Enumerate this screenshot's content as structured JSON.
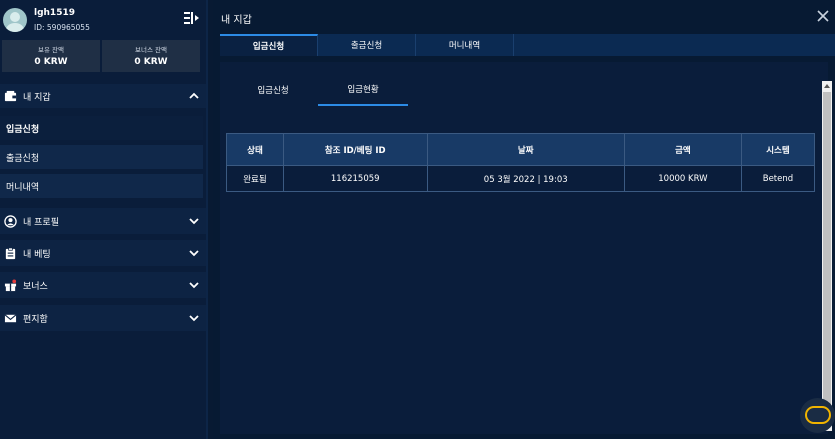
{
  "user": {
    "name": "lgh1519",
    "id": "ID: 590965055"
  },
  "balances": [
    {
      "label": "보유 잔액",
      "value": "0 KRW"
    },
    {
      "label": "보너스 잔액",
      "value": "0 KRW"
    }
  ],
  "sidebar": {
    "wallet": {
      "label": "내 지갑",
      "icon": "wallet-icon"
    },
    "wallet_items": [
      {
        "label": "입금신청",
        "active": true
      },
      {
        "label": "출금신청",
        "active": false
      },
      {
        "label": "머니내역",
        "active": false
      }
    ],
    "profile": {
      "label": "내 프로필",
      "icon": "user-icon"
    },
    "bets": {
      "label": "내 베팅",
      "icon": "clipboard-icon"
    },
    "bonus": {
      "label": "보너스",
      "icon": "gift-icon"
    },
    "mail": {
      "label": "편지함",
      "icon": "mail-icon"
    }
  },
  "panel": {
    "title": "내 지갑"
  },
  "tabs": [
    "입금신청",
    "출금신청",
    "머니내역"
  ],
  "subtabs": [
    "입금신청",
    "입금현황"
  ],
  "table": {
    "headers": [
      "상태",
      "참조 ID/베팅 ID",
      "날짜",
      "금액",
      "시스템"
    ],
    "rows": [
      [
        "완료됨",
        "116215059",
        "05 3월 2022 | 19:03",
        "10000 KRW",
        "Betend"
      ]
    ]
  },
  "colors": {
    "accent": "#2c8be6",
    "sidebar_bg": "#0a1d3a",
    "main_bg": "#071a33",
    "header_row": "#183a66",
    "fab_ring": "#f0b400"
  }
}
